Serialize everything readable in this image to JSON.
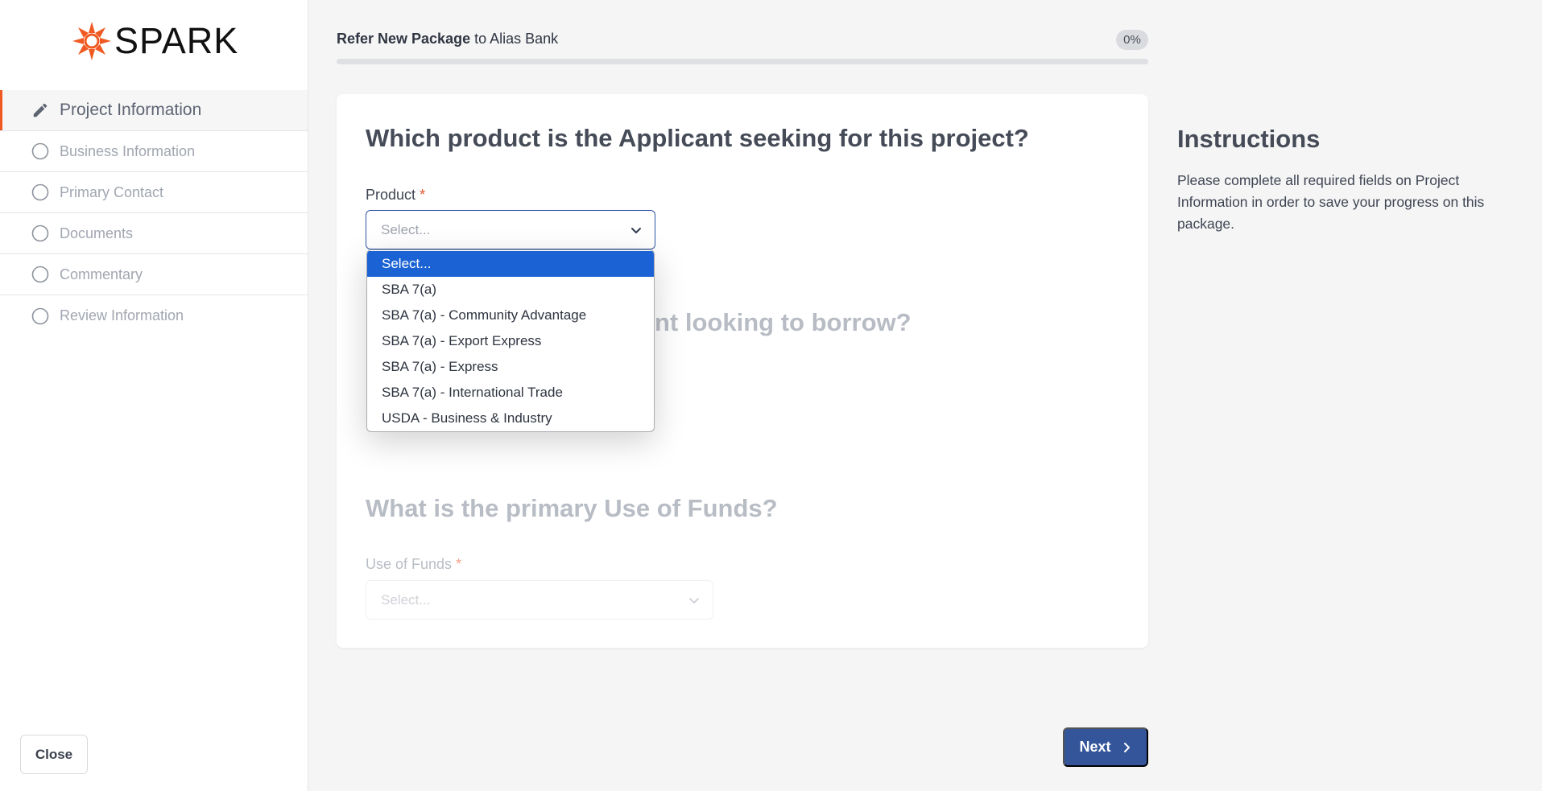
{
  "brand": {
    "name": "SPARK",
    "accent": "#f05a22"
  },
  "sidebar": {
    "steps": [
      {
        "label": "Project Information",
        "icon": "pencil-icon",
        "active": true
      },
      {
        "label": "Business Information",
        "icon": "circle-icon",
        "active": false
      },
      {
        "label": "Primary Contact",
        "icon": "circle-icon",
        "active": false
      },
      {
        "label": "Documents",
        "icon": "circle-icon",
        "active": false
      },
      {
        "label": "Commentary",
        "icon": "circle-icon",
        "active": false
      },
      {
        "label": "Review Information",
        "icon": "circle-icon",
        "active": false
      }
    ],
    "close_label": "Close"
  },
  "header": {
    "title_bold": "Refer New Package",
    "title_rest": " to Alias Bank",
    "progress_label": "0%",
    "progress_value": 0
  },
  "form": {
    "q1": {
      "title": "Which product is the Applicant seeking for this project?",
      "label": "Product",
      "required_mark": "*",
      "placeholder": "Select...",
      "options": [
        "Select...",
        "SBA 7(a)",
        "SBA 7(a) - Community Advantage",
        "SBA 7(a) - Export Express",
        "SBA 7(a) - Express",
        "SBA 7(a) - International Trade",
        "USDA - Business & Industry"
      ],
      "selected_index": 0
    },
    "q2": {
      "title_partial": "nt looking to borrow?"
    },
    "q3": {
      "title": "What is the primary Use of Funds?",
      "label": "Use of Funds",
      "required_mark": "*",
      "placeholder": "Select..."
    }
  },
  "instructions": {
    "title": "Instructions",
    "text": "Please complete all required fields on Project Information in order to save your progress on this package."
  },
  "footer": {
    "next_label": "Next"
  }
}
